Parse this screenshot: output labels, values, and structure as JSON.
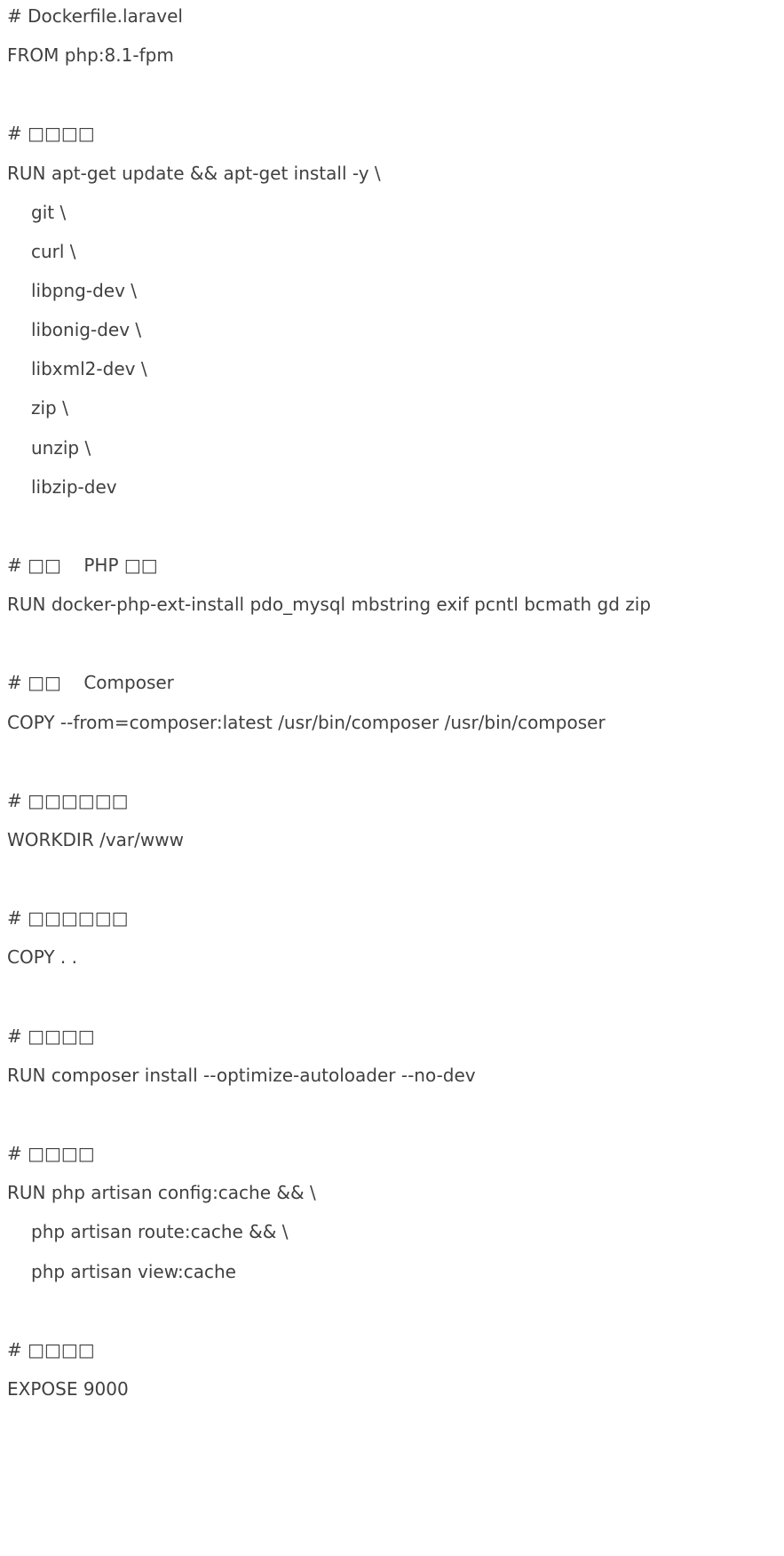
{
  "document": {
    "lines": [
      {
        "text": "# Dockerfile.laravel",
        "indent": false
      },
      {
        "text": "FROM php:8.1-fpm",
        "indent": false
      },
      {
        "text": "",
        "indent": false
      },
      {
        "text": "# □□□□",
        "indent": false
      },
      {
        "text": "RUN apt-get update && apt-get install -y \\",
        "indent": false
      },
      {
        "text": "git \\",
        "indent": true
      },
      {
        "text": "curl \\",
        "indent": true
      },
      {
        "text": "libpng-dev \\",
        "indent": true
      },
      {
        "text": "libonig-dev \\",
        "indent": true
      },
      {
        "text": "libxml2-dev \\",
        "indent": true
      },
      {
        "text": "zip \\",
        "indent": true
      },
      {
        "text": "unzip \\",
        "indent": true
      },
      {
        "text": "libzip-dev",
        "indent": true
      },
      {
        "text": "",
        "indent": false
      },
      {
        "text": "# □□    PHP □□",
        "indent": false
      },
      {
        "text": "RUN docker-php-ext-install pdo_mysql mbstring exif pcntl bcmath gd zip",
        "indent": false
      },
      {
        "text": "",
        "indent": false
      },
      {
        "text": "# □□    Composer",
        "indent": false
      },
      {
        "text": "COPY --from=composer:latest /usr/bin/composer /usr/bin/composer",
        "indent": false
      },
      {
        "text": "",
        "indent": false
      },
      {
        "text": "# □□□□□□",
        "indent": false
      },
      {
        "text": "WORKDIR /var/www",
        "indent": false
      },
      {
        "text": "",
        "indent": false
      },
      {
        "text": "# □□□□□□",
        "indent": false
      },
      {
        "text": "COPY . .",
        "indent": false
      },
      {
        "text": "",
        "indent": false
      },
      {
        "text": "# □□□□",
        "indent": false
      },
      {
        "text": "RUN composer install --optimize-autoloader --no-dev",
        "indent": false
      },
      {
        "text": "",
        "indent": false
      },
      {
        "text": "# □□□□",
        "indent": false
      },
      {
        "text": "RUN php artisan config:cache && \\",
        "indent": false
      },
      {
        "text": "php artisan route:cache && \\",
        "indent": true
      },
      {
        "text": "php artisan view:cache",
        "indent": true
      },
      {
        "text": "",
        "indent": false
      },
      {
        "text": "# □□□□",
        "indent": false
      },
      {
        "text": "EXPOSE 9000",
        "indent": false
      }
    ]
  }
}
